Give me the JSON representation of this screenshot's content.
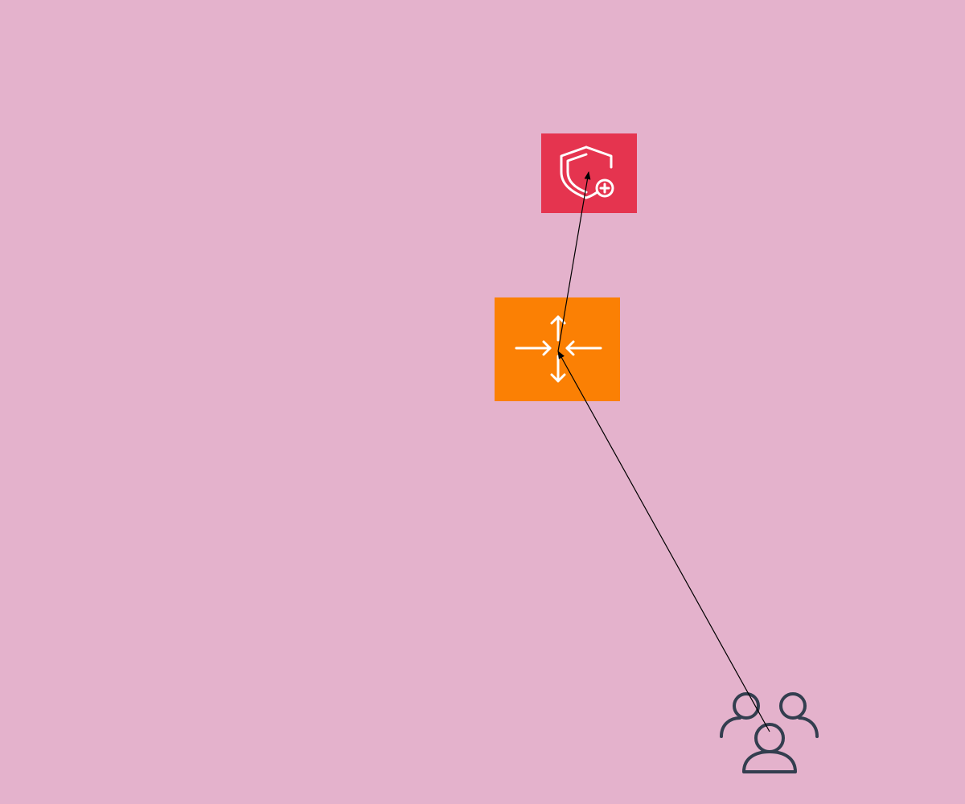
{
  "diagram": {
    "background_color": "#E4B2CC",
    "edge_color": "#000000",
    "nodes": [
      {
        "id": "shield",
        "icon": "shield-plus-icon",
        "color": "#E5344F",
        "icon_color": "#FFFFFF"
      },
      {
        "id": "router",
        "icon": "move-arrows-icon",
        "color": "#FB8004",
        "icon_color": "#FFFFFF"
      },
      {
        "id": "users",
        "icon": "users-group-icon",
        "color": "#333E4F"
      }
    ],
    "edges": [
      {
        "from": "users",
        "to": "router"
      },
      {
        "from": "router",
        "to": "shield"
      }
    ]
  }
}
